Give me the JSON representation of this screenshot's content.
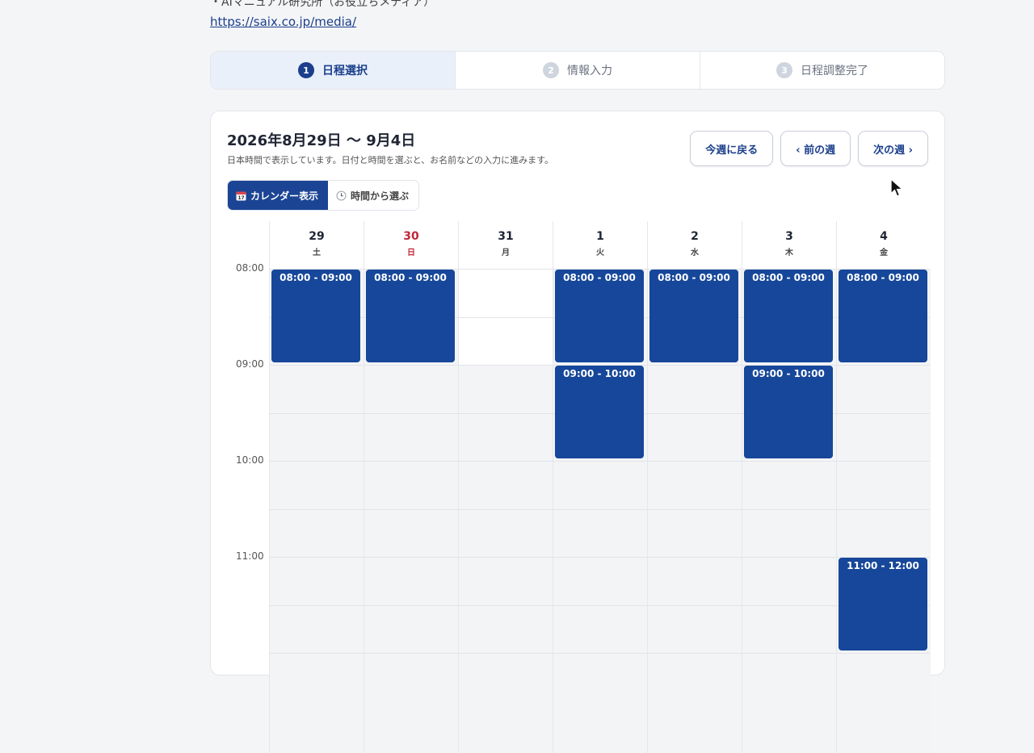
{
  "intro": {
    "line": "・AIマニュアル研究所（お役立ちメディア）",
    "link": "https://saix.co.jp/media/"
  },
  "steps": [
    {
      "num": "1",
      "label": "日程選択",
      "active": true
    },
    {
      "num": "2",
      "label": "情報入力",
      "active": false
    },
    {
      "num": "3",
      "label": "日程調整完了",
      "active": false
    }
  ],
  "header": {
    "range": "2026年8月29日 〜 9月4日",
    "subtitle": "日本時間で表示しています。日付と時間を選ぶと、お名前などの入力に進みます。",
    "today_button": "今週に戻る",
    "prev_button": "‹ 前の週",
    "next_button": "次の週 ›"
  },
  "view_toggle": {
    "calendar": "カレンダー表示",
    "calendar_icon": "calendar-icon",
    "time": "時間から選ぶ",
    "time_icon": "clock-icon"
  },
  "days": [
    {
      "num": "29",
      "weekday": "土",
      "sunday": false
    },
    {
      "num": "30",
      "weekday": "日",
      "sunday": true
    },
    {
      "num": "31",
      "weekday": "月",
      "sunday": false
    },
    {
      "num": "1",
      "weekday": "火",
      "sunday": false
    },
    {
      "num": "2",
      "weekday": "水",
      "sunday": false
    },
    {
      "num": "3",
      "weekday": "木",
      "sunday": false
    },
    {
      "num": "4",
      "weekday": "金",
      "sunday": false
    }
  ],
  "times": [
    "08:00",
    "09:00",
    "10:00",
    "11:00"
  ],
  "slots": [
    {
      "day": 0,
      "start": "08:00",
      "label": "08:00 - 09:00"
    },
    {
      "day": 1,
      "start": "08:00",
      "label": "08:00 - 09:00"
    },
    {
      "day": 3,
      "start": "08:00",
      "label": "08:00 - 09:00"
    },
    {
      "day": 3,
      "start": "09:00",
      "label": "09:00 - 10:00"
    },
    {
      "day": 4,
      "start": "08:00",
      "label": "08:00 - 09:00"
    },
    {
      "day": 5,
      "start": "08:00",
      "label": "08:00 - 09:00"
    },
    {
      "day": 5,
      "start": "09:00",
      "label": "09:00 - 10:00"
    },
    {
      "day": 6,
      "start": "08:00",
      "label": "08:00 - 09:00"
    },
    {
      "day": 6,
      "start": "11:00",
      "label": "11:00 - 12:00"
    }
  ]
}
